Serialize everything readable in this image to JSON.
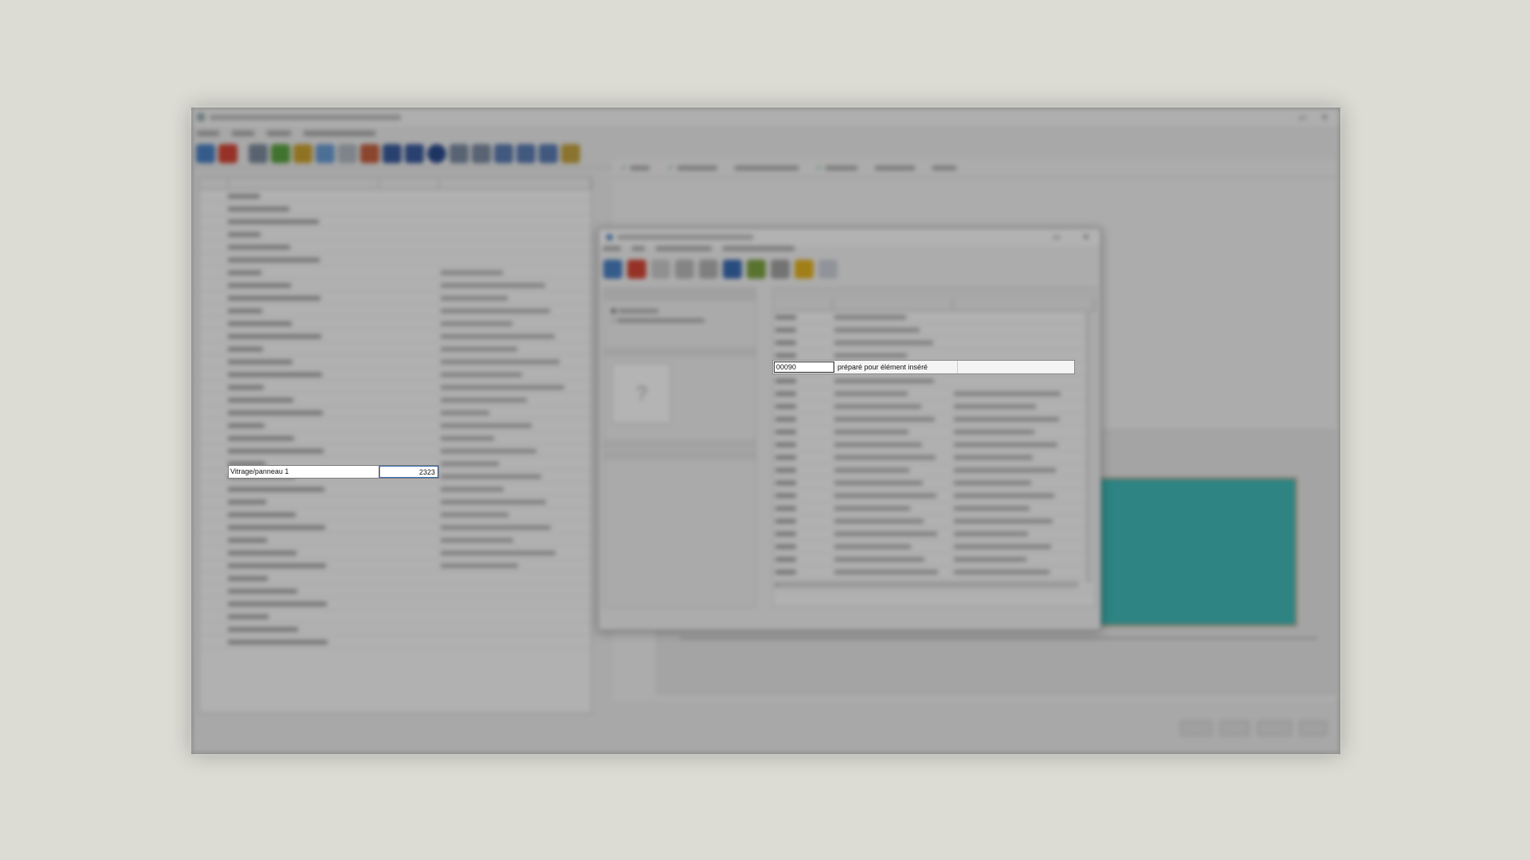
{
  "highlight": {
    "tree_row": {
      "label": "Vitrage/panneau 1",
      "value": "2323"
    },
    "lookup_row": {
      "code": "00090",
      "description": "préparé pour élément inséré"
    }
  },
  "colors": {
    "background": "#dcdcd4",
    "glass": "#3fb7b5",
    "check": "#2a9d2a"
  }
}
